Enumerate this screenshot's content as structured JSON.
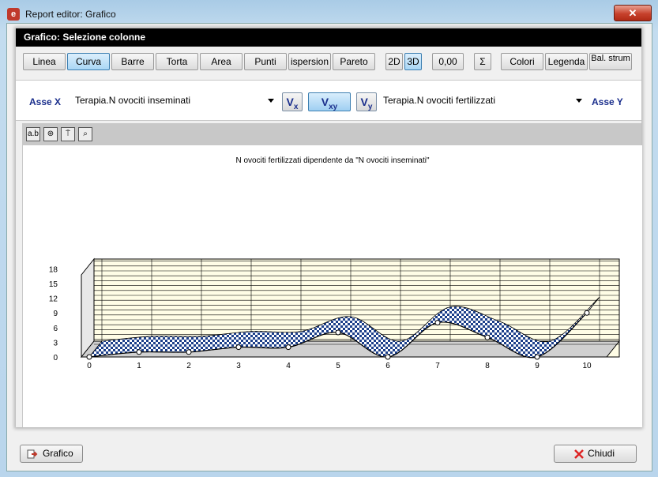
{
  "window": {
    "title": "Report editor: Grafico",
    "close_glyph": "✕"
  },
  "panel": {
    "header": "Grafico: Selezione colonne"
  },
  "toolbar": {
    "chart_types": [
      "Linea",
      "Curva",
      "Barre",
      "Torta",
      "Area",
      "Punti",
      "ispersion",
      "Pareto"
    ],
    "active_type": "Curva",
    "btn_2d": "2D",
    "btn_3d": "3D",
    "btn_decimals": "0,00",
    "btn_sum": "Σ",
    "btn_colors": "Colori",
    "btn_legend": "Legenda",
    "btn_toolbar": "Bal. strum"
  },
  "axes": {
    "x_label": "Asse X",
    "x_value": "Terapia.N ovociti inseminati",
    "y_label": "Asse Y",
    "y_value": "Terapia.N ovociti fertilizzati",
    "vx": "V",
    "vx_sub": "x",
    "vxy": "V",
    "vxy_sub": "xy",
    "vy": "V",
    "vy_sub": "y"
  },
  "chart_tools": [
    "text-tool-icon",
    "zoom-globe-icon",
    "pointer-tool-icon",
    "magnifier-icon"
  ],
  "chart_data": {
    "type": "line",
    "title": "N ovociti fertilizzati dipendente da \"N ovociti inseminati\"",
    "x": [
      0,
      1,
      2,
      3,
      4,
      5,
      6,
      7,
      8,
      9,
      10
    ],
    "y": [
      0,
      1,
      1,
      2,
      2,
      5,
      0,
      7,
      4,
      0,
      9
    ],
    "xlim": [
      0,
      10
    ],
    "ylim": [
      0,
      20
    ],
    "y_ticks": [
      0,
      3,
      6,
      9,
      12,
      15,
      18
    ],
    "grid": true,
    "three_d": true,
    "colors": {
      "ribbon": "#1c3f8a",
      "wall": "#fffde6",
      "grid": "#000000",
      "floor": "#d0d0d0"
    }
  },
  "bottom": {
    "chart_button": "Grafico",
    "close_button": "Chiudi"
  }
}
